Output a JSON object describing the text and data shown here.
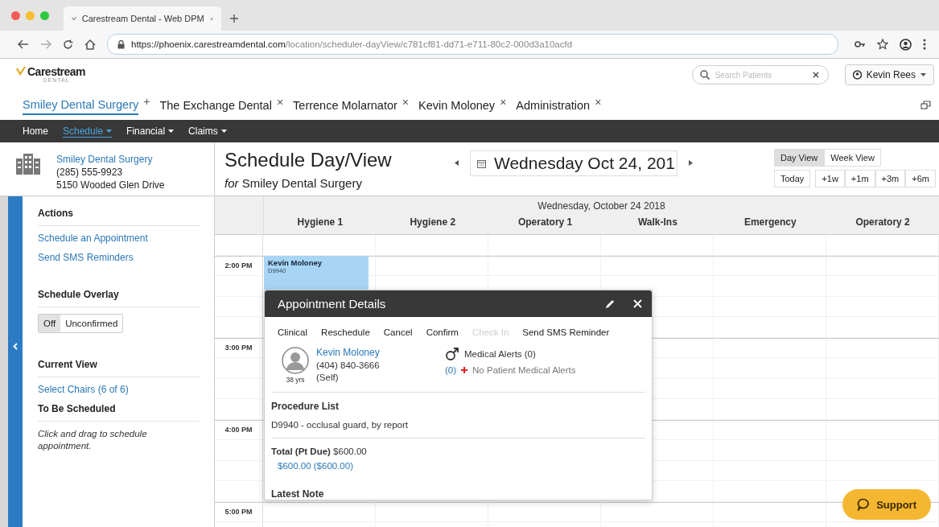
{
  "browser": {
    "tab_title": "Carestream Dental - Web DPM",
    "url_host": "https://phoenix.carestreamdental.com",
    "url_path": "/location/scheduler-dayView/c781cf81-dd71-e711-80c2-000d3a10acfd"
  },
  "header": {
    "logo": "Carestream",
    "logo_sub": "DENTAL",
    "search": {
      "placeholder": "Search Patients"
    },
    "user": "Kevin Rees"
  },
  "location_tabs": [
    {
      "label": "Smiley Dental Surgery",
      "action": "+",
      "selected": true
    },
    {
      "label": "The Exchange Dental",
      "action": "×",
      "selected": false
    },
    {
      "label": "Terrence Molarnator",
      "action": "×",
      "selected": false
    },
    {
      "label": "Kevin Moloney",
      "action": "×",
      "selected": false
    },
    {
      "label": "Administration",
      "action": "×",
      "selected": false
    }
  ],
  "nav": [
    {
      "label": "Home",
      "selected": false,
      "menu": false
    },
    {
      "label": "Schedule",
      "selected": true,
      "menu": true
    },
    {
      "label": "Financial",
      "selected": false,
      "menu": true
    },
    {
      "label": "Claims",
      "selected": false,
      "menu": true
    }
  ],
  "practice": {
    "name": "Smiley Dental Surgery",
    "phone": "(285) 555-9923",
    "address": "5150 Wooded Glen Drive"
  },
  "sidebar": {
    "actions_heading": "Actions",
    "actions": [
      "Schedule an Appointment",
      "Send SMS Reminders"
    ],
    "overlay_heading": "Schedule Overlay",
    "overlay_options": [
      {
        "label": "Off",
        "selected": true
      },
      {
        "label": "Unconfirmed",
        "selected": false
      }
    ],
    "view_heading": "Current View",
    "view_link": "Select Chairs (6 of 6)",
    "unscheduled_heading": "To Be Scheduled",
    "unscheduled_hint": "Click and drag to schedule appointment."
  },
  "schedule": {
    "title": "Schedule Day/View",
    "subtitle": "*for* Smiley Dental Surgery",
    "date": "Wednesday Oct 24, 201",
    "views": [
      {
        "label": "Day View",
        "selected": true
      },
      {
        "label": "Week View",
        "selected": false
      }
    ],
    "today": "Today",
    "jumps": [
      "+1w",
      "+1m",
      "+3m",
      "+6m"
    ]
  },
  "grid": {
    "date_heading": "Wednesday, October 24 2018",
    "columns": [
      "Hygiene 1",
      "Hygiene 2",
      "Operatory 1",
      "Walk-Ins",
      "Emergency",
      "Operatory 2"
    ],
    "hours": [
      "2:00 PM",
      "3:00 PM",
      "4:00 PM",
      "5:00 PM"
    ],
    "appointment": {
      "patient": "Kevin Moloney",
      "code": "D9940"
    }
  },
  "details": {
    "title": "Appointment Details",
    "actions": [
      {
        "label": "Clinical",
        "disabled": false
      },
      {
        "label": "Reschedule",
        "disabled": false
      },
      {
        "label": "Cancel",
        "disabled": false
      },
      {
        "label": "Confirm",
        "disabled": false
      },
      {
        "label": "Check In",
        "disabled": true
      },
      {
        "label": "Send SMS Reminder",
        "disabled": false
      }
    ],
    "patient": "Kevin Moloney",
    "phone": "(404) 840-3666",
    "relation": "(Self)",
    "age": "38 yrs",
    "alerts_heading": "Medical Alerts (0)",
    "alert_count": "(0)",
    "alert_text": "No Patient Medical Alerts",
    "procedure_heading": "Procedure List",
    "procedure": "D9940 - occlusal guard, by report",
    "total": "**Total (Pt Due)** $600.00",
    "amount": "$600.00 ($600.00)",
    "note_heading": "Latest Note"
  },
  "support": "Support"
}
